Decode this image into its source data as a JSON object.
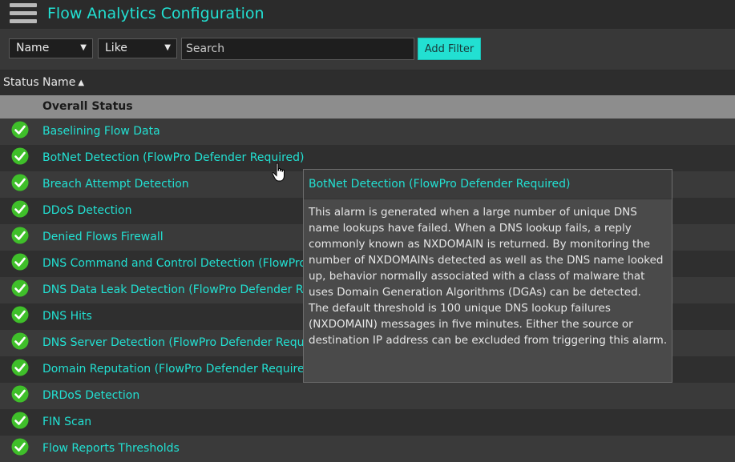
{
  "app": {
    "title": "Flow Analytics Configuration"
  },
  "filter": {
    "field_select": "Name",
    "operator_select": "Like",
    "search_placeholder": "Search",
    "add_button": "Add Filter"
  },
  "table": {
    "columns": {
      "status": "Status",
      "name": "Name"
    },
    "group_label": "Overall Status",
    "rows": [
      {
        "name": "Baselining Flow Data",
        "status": "ok"
      },
      {
        "name": "BotNet Detection (FlowPro Defender Required)",
        "status": "ok"
      },
      {
        "name": "Breach Attempt Detection",
        "status": "ok"
      },
      {
        "name": "DDoS Detection",
        "status": "ok"
      },
      {
        "name": "Denied Flows Firewall",
        "status": "ok"
      },
      {
        "name": "DNS Command and Control Detection (FlowPro",
        "status": "ok"
      },
      {
        "name": "DNS Data Leak Detection (FlowPro Defender Re",
        "status": "ok"
      },
      {
        "name": "DNS Hits",
        "status": "ok"
      },
      {
        "name": "DNS Server Detection (FlowPro Defender Requ",
        "status": "ok"
      },
      {
        "name": "Domain Reputation (FlowPro Defender Require",
        "status": "ok"
      },
      {
        "name": "DRDoS Detection",
        "status": "ok"
      },
      {
        "name": "FIN Scan",
        "status": "ok"
      },
      {
        "name": "Flow Reports Thresholds",
        "status": "ok"
      }
    ]
  },
  "tooltip": {
    "title": "BotNet Detection (FlowPro Defender Required)",
    "paragraph1": "This alarm is generated when a large number of unique DNS name lookups have failed. When a DNS lookup fails, a reply commonly known as NXDOMAIN is returned. By monitoring the number of NXDOMAINs detected as well as the DNS name looked up, behavior normally associated with a class of malware that uses Domain Generation Algorithms (DGAs) can be detected.",
    "paragraph2": "The default threshold is 100 unique DNS lookup failures (NXDOMAIN) messages in five minutes. Either the source or destination IP address can be excluded from triggering this alarm."
  },
  "colors": {
    "accent": "#22e0d2",
    "status_ok": "#3fbf2a",
    "background": "#3a3a3a"
  },
  "icons": {
    "menu": "hamburger-menu-icon",
    "status_ok": "checkmark-circle-icon",
    "sort": "sort-ascending-icon",
    "dropdown": "chevron-down-icon",
    "pointer": "hand-pointer-icon"
  }
}
